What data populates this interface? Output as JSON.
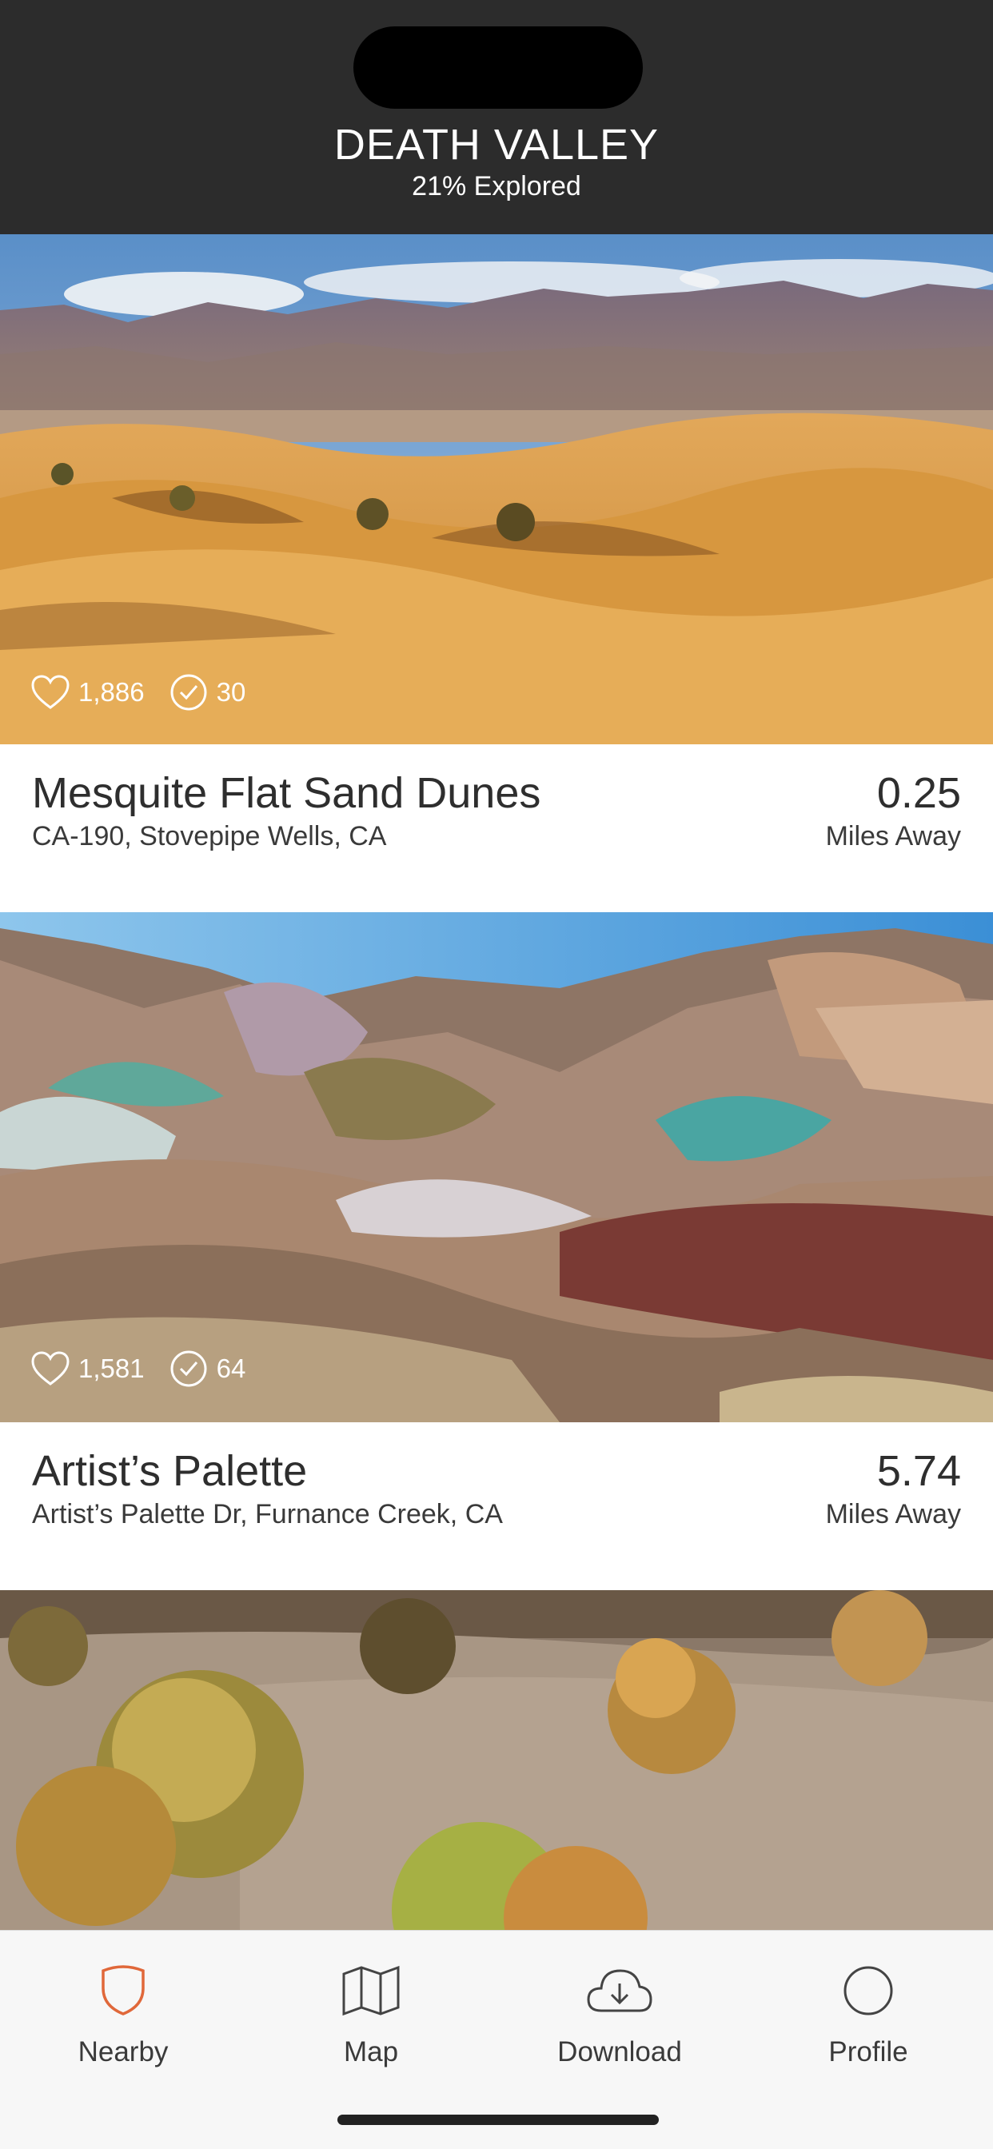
{
  "header": {
    "title": "DEATH VALLEY",
    "subtitle": "21% Explored"
  },
  "cards": [
    {
      "name": "Mesquite Flat Sand Dunes",
      "address": "CA-190, Stovepipe Wells, CA",
      "distance": "0.25",
      "distance_unit": "Miles Away",
      "likes": "1,886",
      "checkins": "30"
    },
    {
      "name": "Artist’s Palette",
      "address": "Artist’s Palette Dr, Furnance Creek, CA",
      "distance": "5.74",
      "distance_unit": "Miles Away",
      "likes": "1,581",
      "checkins": "64"
    }
  ],
  "tabbar": {
    "items": [
      {
        "label": "Nearby",
        "icon": "shield-icon",
        "active": true
      },
      {
        "label": "Map",
        "icon": "map-icon",
        "active": false
      },
      {
        "label": "Download",
        "icon": "cloud-download-icon",
        "active": false
      },
      {
        "label": "Profile",
        "icon": "profile-circle-icon",
        "active": false
      }
    ]
  },
  "colors": {
    "header_bg": "#2c2c2c",
    "accent": "#e0683a",
    "tabbar_bg": "#f7f7f7"
  }
}
